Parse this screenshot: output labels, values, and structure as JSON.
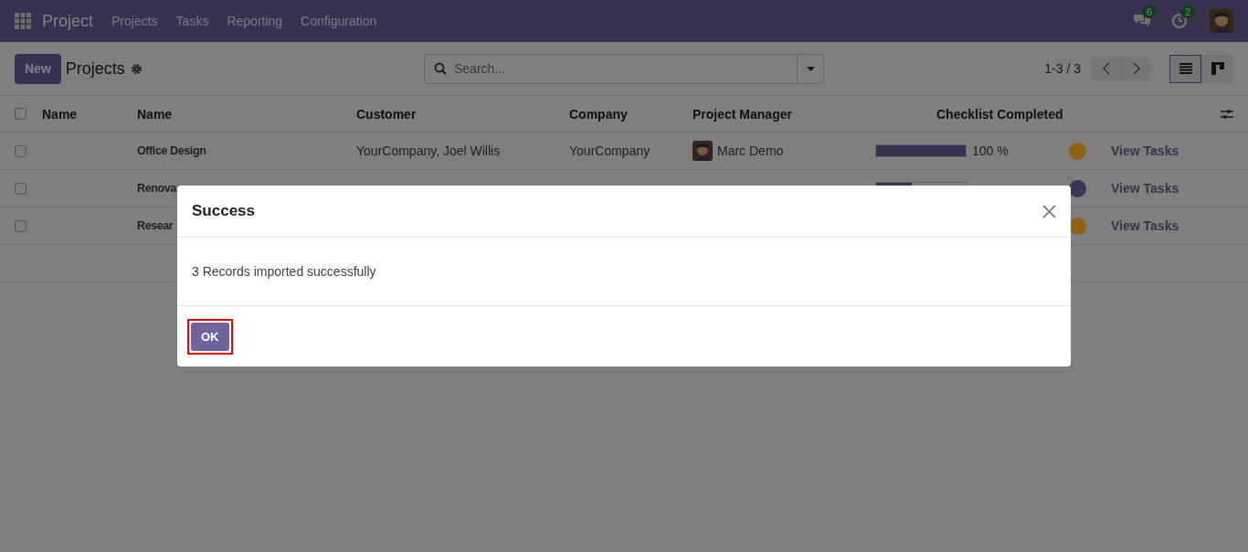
{
  "navbar": {
    "app_name": "Project",
    "menu": [
      "Projects",
      "Tasks",
      "Reporting",
      "Configuration"
    ],
    "messages_badge": "6",
    "activities_badge": "2"
  },
  "control_panel": {
    "new_button": "New",
    "title": "Projects",
    "search": {
      "placeholder": "Search..."
    },
    "pager": "1-3 / 3",
    "views": [
      {
        "kind": "list",
        "selected": true
      },
      {
        "kind": "kanban",
        "selected": false
      }
    ]
  },
  "table": {
    "all_selected": false,
    "columns": [
      "Name",
      "Name",
      "Customer",
      "Company",
      "Project Manager",
      "Checklist Completed"
    ],
    "rows": [
      {
        "checked": false,
        "name": "Office Design",
        "customer": "YourCompany, Joel Willis",
        "company": "YourCompany",
        "manager": "Marc Demo",
        "checklist": {
          "level": 1,
          "reading": "100 %"
        },
        "color": "#8c6414",
        "link": "View Tasks"
      },
      {
        "checked": false,
        "name": "Renova",
        "checklist": {
          "level": 0.4
        },
        "color": "#3f3657",
        "link": "View Tasks"
      },
      {
        "checked": false,
        "name": "Resear",
        "color": "#8c6414",
        "link": "View Tasks"
      }
    ]
  },
  "dialog": {
    "title": "Success",
    "message": "3 Records imported successfully",
    "buttons": [
      {
        "label": "OK",
        "highlighted": true
      }
    ]
  }
}
